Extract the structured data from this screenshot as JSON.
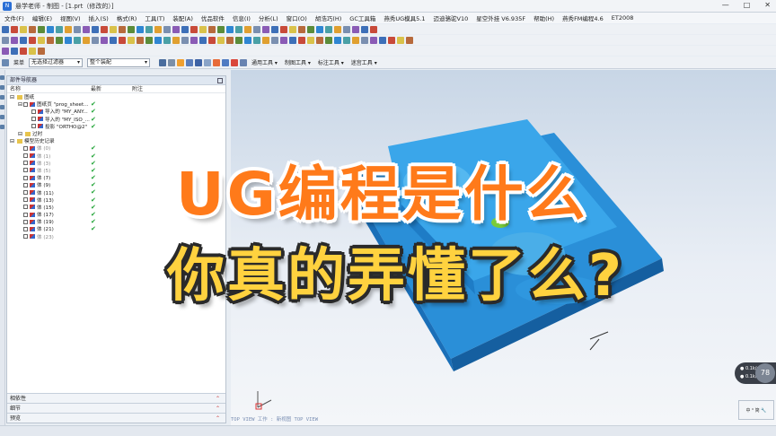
{
  "window": {
    "title": "悬学老师 - 制图 - [1.prt（修改的）]",
    "controls": [
      "—",
      "□",
      "✕"
    ]
  },
  "menu": [
    "文件(F)",
    "编辑(E)",
    "视图(V)",
    "插入(S)",
    "格式(R)",
    "工具(T)",
    "装配(A)",
    "优品软件",
    "信息(I)",
    "分析(L)",
    "窗口(O)",
    "胡浩巧(H)",
    "GC工具箱",
    "燕秀UG模具5.1",
    "迈迪骆驼V10",
    "星空外挂 V6.935F",
    "帮助(H)",
    "燕秀FM编程4.6",
    "ET2008"
  ],
  "toolbar_row4": {
    "menu_btn": "菜单",
    "filter_combo": "无选择过滤器",
    "scope_combo": "整个装配",
    "groups": [
      "通用工具 ▾",
      "制图工具 ▾",
      "标注工具 ▾",
      "迷宫工具 ▾"
    ]
  },
  "navigator": {
    "title": "部件导航器",
    "columns": [
      "名称",
      "最新",
      "附注"
    ],
    "rows": [
      {
        "indent": 0,
        "label": "图纸",
        "check": false,
        "kind": "folder"
      },
      {
        "indent": 1,
        "label": "图纸页 \"prog_sheet...",
        "check": true,
        "kind": "sheet"
      },
      {
        "indent": 2,
        "label": "导入的 \"MY_ANY...",
        "check": true,
        "kind": "view"
      },
      {
        "indent": 2,
        "label": "导入的 \"MY_ISO_...",
        "check": true,
        "kind": "view"
      },
      {
        "indent": 2,
        "label": "投影 \"ORTHO@2\"",
        "check": true,
        "kind": "view"
      },
      {
        "indent": 1,
        "label": "过时",
        "check": false,
        "kind": "folder"
      },
      {
        "indent": 0,
        "label": "模型历史记录",
        "check": false,
        "kind": "folder"
      },
      {
        "indent": 1,
        "label": "体 (0)",
        "check": true,
        "kind": "feat",
        "grey": true
      },
      {
        "indent": 1,
        "label": "体 (1)",
        "check": true,
        "kind": "feat",
        "grey": true
      },
      {
        "indent": 1,
        "label": "体 (3)",
        "check": true,
        "kind": "feat",
        "grey": true
      },
      {
        "indent": 1,
        "label": "体 (5)",
        "check": true,
        "kind": "feat",
        "grey": true
      },
      {
        "indent": 1,
        "label": "体 (7)",
        "check": true,
        "kind": "feat"
      },
      {
        "indent": 1,
        "label": "体 (9)",
        "check": true,
        "kind": "feat"
      },
      {
        "indent": 1,
        "label": "体 (11)",
        "check": true,
        "kind": "feat"
      },
      {
        "indent": 1,
        "label": "体 (13)",
        "check": true,
        "kind": "feat"
      },
      {
        "indent": 1,
        "label": "体 (15)",
        "check": true,
        "kind": "feat"
      },
      {
        "indent": 1,
        "label": "体 (17)",
        "check": true,
        "kind": "feat"
      },
      {
        "indent": 1,
        "label": "体 (19)",
        "check": true,
        "kind": "feat"
      },
      {
        "indent": 1,
        "label": "体 (21)",
        "check": true,
        "kind": "feat"
      },
      {
        "indent": 1,
        "label": "体 (23)",
        "check": false,
        "kind": "feat",
        "grey": true
      }
    ],
    "panels": [
      "相依性",
      "细节",
      "预览"
    ]
  },
  "viewport": {
    "status_text": "TOP VIEW  工作 : 新视图 TOP VIEW"
  },
  "headline": {
    "line1": "UG编程是什么",
    "line2": "你真的弄懂了么?"
  },
  "speed_widget": {
    "up": "0.1k/s",
    "down": "0.1k/s",
    "percent": "78"
  },
  "bottom_box": "中 ⁰ 简 🔧"
}
